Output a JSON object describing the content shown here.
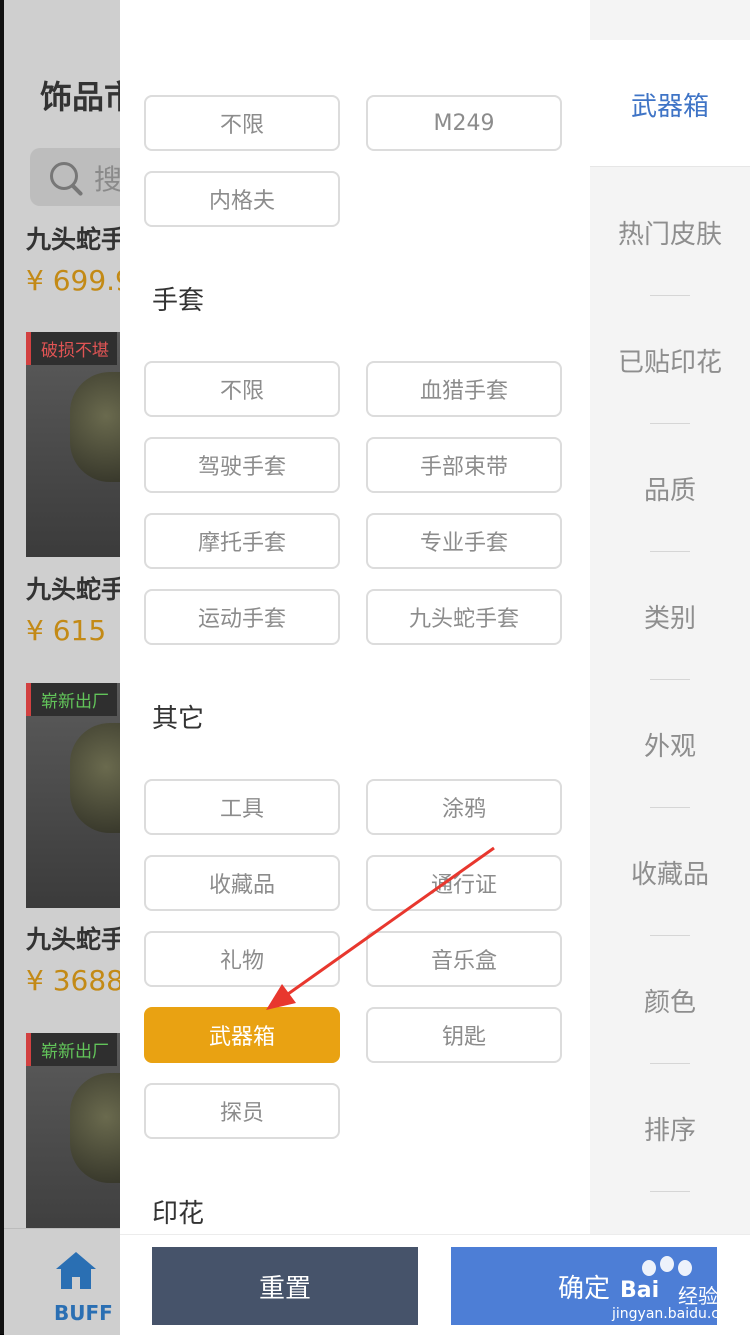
{
  "background_app": {
    "title": "饰品市",
    "search_placeholder": "搜",
    "items": [
      {
        "name": "九头蛇手",
        "price": "¥ 699.9",
        "badge": "",
        "badge_color": ""
      },
      {
        "name": "九头蛇手",
        "price": "¥ 615",
        "badge": "破损不堪",
        "badge_color": "#e05454"
      },
      {
        "name": "九头蛇手",
        "price": "¥ 3688",
        "badge": "崭新出厂",
        "badge_color": "#62c45a"
      },
      {
        "name": "",
        "price": "",
        "badge": "崭新出厂",
        "badge_color": "#62c45a"
      }
    ],
    "tabbar": {
      "home_label": "BUFF"
    }
  },
  "filter": {
    "top_options": [
      "不限",
      "M249",
      "内格夫"
    ],
    "sections": [
      {
        "title": "手套",
        "options": [
          "不限",
          "血猎手套",
          "驾驶手套",
          "手部束带",
          "摩托手套",
          "专业手套",
          "运动手套",
          "九头蛇手套"
        ]
      },
      {
        "title": "其它",
        "options": [
          "工具",
          "涂鸦",
          "收藏品",
          "通行证",
          "礼物",
          "音乐盒",
          "武器箱",
          "钥匙",
          "探员"
        ]
      },
      {
        "title": "印花",
        "options": []
      }
    ],
    "selected_option": "武器箱"
  },
  "categories": {
    "active": "武器箱",
    "items": [
      "热门皮肤",
      "已贴印花",
      "品质",
      "类别",
      "外观",
      "收藏品",
      "颜色",
      "排序"
    ]
  },
  "footer": {
    "reset_label": "重置",
    "confirm_label": "确定"
  },
  "watermark": {
    "text": "Bai",
    "text2": "经验",
    "url": "jingyan.baidu.com"
  },
  "colors": {
    "accent_selected": "#e9a212",
    "active_category": "#3f74c6",
    "reset_bg": "#46536a",
    "confirm_bg": "#4d7ed6",
    "annotation_arrow": "#e8372e"
  }
}
